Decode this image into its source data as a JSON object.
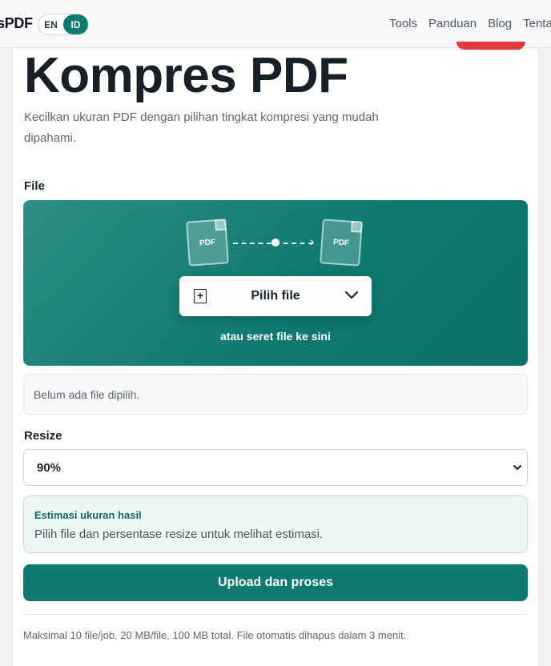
{
  "header": {
    "brand": "sPDF",
    "lang": {
      "en": "EN",
      "id": "ID",
      "active": "ID"
    },
    "nav": [
      "Tools",
      "Panduan",
      "Blog",
      "Tentang"
    ]
  },
  "page": {
    "title": "Kompres PDF",
    "subtitle": "Kecilkan ukuran PDF dengan pilihan tingkat kompresi yang mudah dipahami."
  },
  "file_section": {
    "label": "File",
    "doc_label": "PDF",
    "pick_button": "Pilih file",
    "drop_hint": "atau seret file ke sini",
    "status": "Belum ada file dipilih."
  },
  "resize_section": {
    "label": "Resize",
    "selected": "90%"
  },
  "estimate": {
    "title": "Estimasi ukuran hasil",
    "text": "Pilih file dan persentase resize untuk melihat estimasi."
  },
  "submit_label": "Upload dan proses",
  "footnote": "Maksimal 10 file/job, 20 MB/file, 100 MB total. File otomatis dihapus dalam 3 menit.",
  "colors": {
    "accent": "#0f7a70",
    "estimate_bg": "#eef7f4",
    "alert": "#e03a3a"
  }
}
